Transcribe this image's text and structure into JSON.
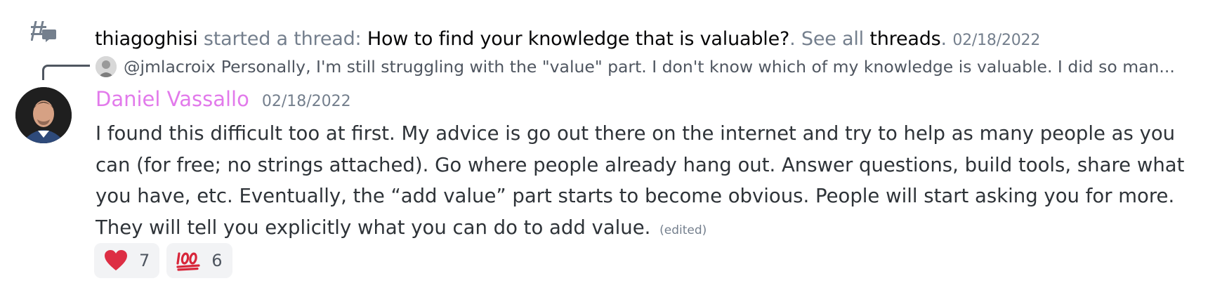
{
  "thread": {
    "icon": "thread-icon",
    "starter": "thiagoghisi",
    "action": " started a thread: ",
    "title": "How to find your knowledge that is valuable?",
    "after_title": ". See all ",
    "link": "threads",
    "link_suffix": ".",
    "timestamp": "02/18/2022"
  },
  "reply": {
    "avatar_icon": "avatar",
    "username": "@jmlacroix",
    "snippet": "Personally, I'm still struggling with the \"value\" part. I don't know which of my knowledge is valuable. I did so man..."
  },
  "message": {
    "author": "Daniel Vassallo",
    "author_color": "#e27aeb",
    "timestamp": "02/18/2022",
    "lines": [
      "I found this difficult too at first. My advice is go out there on the internet and try to help as many people as you",
      "can (for free; no strings attached). Go where people already hang out. Answer questions, build tools, share what",
      "you have, etc.  Eventually, the “add value” part starts to become obvious. People will start asking you for more.",
      "They will tell you explicitly what you can do to add value."
    ],
    "edited": "(edited)"
  },
  "reactions": [
    {
      "icon": "heart-emoji-icon",
      "count": "7"
    },
    {
      "icon": "hundred-points-emoji-icon",
      "count": "6"
    }
  ]
}
